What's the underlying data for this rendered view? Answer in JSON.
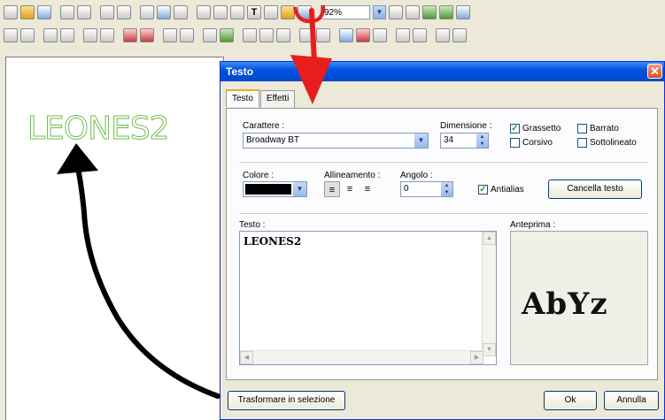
{
  "toolbar": {
    "zoom_value": "92%"
  },
  "canvas": {
    "text": "LEONES2"
  },
  "dialog": {
    "title": "Testo",
    "close_symbol": "✕",
    "tabs": [
      {
        "label": "Testo",
        "active": true
      },
      {
        "label": "Effetti",
        "active": false
      }
    ],
    "font_label": "Carattere :",
    "font_value": "Broadway BT",
    "size_label": "Dimensione :",
    "size_value": "34",
    "checkboxes": {
      "bold": {
        "label": "Grassetto",
        "checked": true
      },
      "strike": {
        "label": "Barrato",
        "checked": false
      },
      "italic": {
        "label": "Corsivo",
        "checked": false
      },
      "underline": {
        "label": "Sottolineato",
        "checked": false
      },
      "antialias": {
        "label": "Antialias",
        "checked": true
      }
    },
    "color_label": "Colore :",
    "color_value": "#000000",
    "align_label": "Allineamento :",
    "angle_label": "Angolo :",
    "angle_value": "0",
    "clear_button": "Cancella testo",
    "text_label": "Testo :",
    "text_value": "LEONES2",
    "preview_label": "Anteprima :",
    "preview_text": "AbYz",
    "convert_button": "Trasformare in selezione",
    "ok_button": "Ok",
    "cancel_button": "Annulla"
  },
  "colors": {
    "annotation_red": "#e61e1e",
    "annotation_black": "#000000",
    "title_blue": "#0054e3",
    "outline_green": "#6cbe4a"
  }
}
